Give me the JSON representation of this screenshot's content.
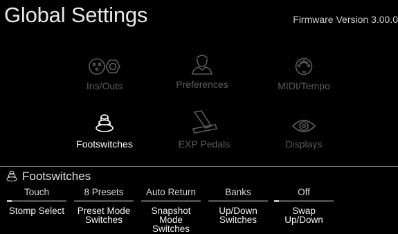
{
  "header": {
    "title": "Global Settings",
    "firmware": "Firmware Version 3.00.0"
  },
  "categories": [
    {
      "label": "Ins/Outs",
      "icon": "ins-outs-icon",
      "state": "dim"
    },
    {
      "label": "Preferences",
      "icon": "person-icon",
      "state": "dim"
    },
    {
      "label": "MIDI/Tempo",
      "icon": "midi-icon",
      "state": "dim"
    },
    {
      "label": "Footswitches",
      "icon": "footswitch-icon",
      "state": "active"
    },
    {
      "label": "EXP Pedals",
      "icon": "pedal-icon",
      "state": "dim"
    },
    {
      "label": "Displays",
      "icon": "eye-icon",
      "state": "dim"
    }
  ],
  "section": {
    "title": "Footswitches",
    "icon": "footswitch-icon"
  },
  "params": [
    {
      "value": "Touch",
      "line1": "Stomp Select",
      "line2": "",
      "level": 0.08
    },
    {
      "value": "8 Presets",
      "line1": "Preset Mode",
      "line2": "Switches",
      "level": 0.0
    },
    {
      "value": "Auto Return",
      "line1": "Snapshot Mode",
      "line2": "Switches",
      "level": 0.0
    },
    {
      "value": "Banks",
      "line1": "Up/Down",
      "line2": "Switches",
      "level": 0.0
    },
    {
      "value": "Off",
      "line1": "Swap",
      "line2": "Up/Down",
      "level": 0.08
    }
  ],
  "colors": {
    "background": "#000000",
    "active": "#ffffff",
    "dim": "#5c5c5c"
  }
}
